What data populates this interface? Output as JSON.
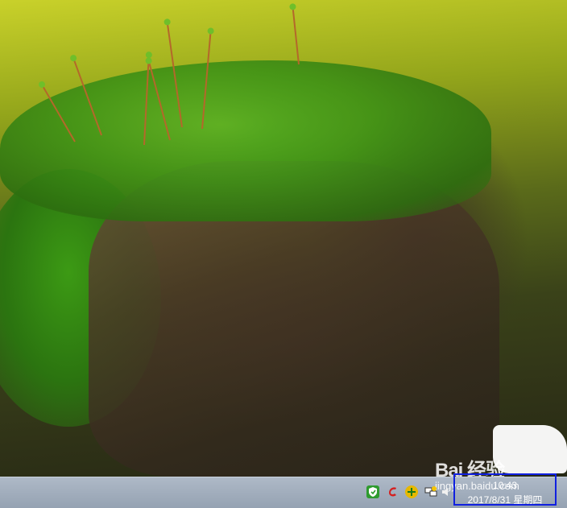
{
  "desktop": {
    "wallpaper": "moss-on-tree-stump"
  },
  "watermark": {
    "logo_text": "Bai 经验",
    "url_text": "jingyan.baidu.com"
  },
  "taskbar": {
    "tray_icons": [
      {
        "name": "security-shield-icon",
        "color": "#2e9b2e"
      },
      {
        "name": "red-app-icon",
        "color": "#d42020"
      },
      {
        "name": "plus-app-icon",
        "color": "#e6b800"
      },
      {
        "name": "network-icon",
        "color": "#6a7a8a"
      },
      {
        "name": "volume-icon",
        "color": "#f0f0f0"
      }
    ],
    "clock": {
      "time": "10:43",
      "date": "2017/8/31 星期四",
      "highlight_color": "#1020e0"
    }
  }
}
